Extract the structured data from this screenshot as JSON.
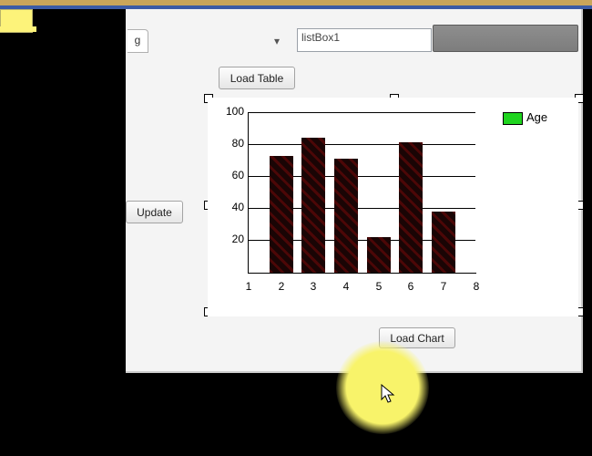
{
  "top": {
    "tab_label": "g",
    "dropdown_glyph": "▾"
  },
  "listbox": {
    "value": "listBox1"
  },
  "buttons": {
    "update": "Update",
    "load_table": "Load Table",
    "load_chart": "Load Chart"
  },
  "legend": {
    "label": "Age"
  },
  "chart_data": {
    "type": "bar",
    "categories": [
      1,
      2,
      3,
      4,
      5,
      6,
      7,
      8
    ],
    "values": [
      null,
      73,
      84,
      71,
      22,
      81,
      38,
      null
    ],
    "series_name": "Age",
    "ylim": [
      0,
      100
    ],
    "yticks": [
      20,
      40,
      60,
      80,
      100
    ],
    "title": "",
    "xlabel": "",
    "ylabel": ""
  }
}
